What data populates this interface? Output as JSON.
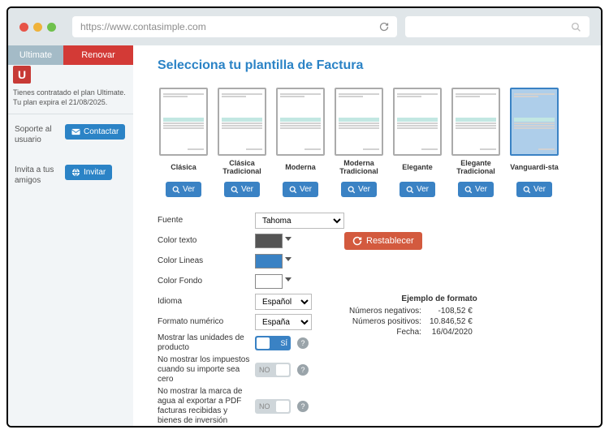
{
  "chrome": {
    "url": "https://www.contasimple.com"
  },
  "sidebar": {
    "plan_name": "Ultimate",
    "renew_label": "Renovar",
    "u_letter": "U",
    "plan_desc": "Tienes contratado el plan Ultimate. Tu plan expira el 21/08/2025.",
    "support_label": "Soporte al usuario",
    "contact_label": "Contactar",
    "invite_label": "Invita a tus amigos",
    "invite_btn": "Invitar"
  },
  "page_title": "Selecciona tu plantilla de Factura",
  "templates": [
    {
      "name": "Clásica"
    },
    {
      "name": "Clásica Tradicional"
    },
    {
      "name": "Moderna"
    },
    {
      "name": "Moderna Tradicional"
    },
    {
      "name": "Elegante"
    },
    {
      "name": "Elegante Tradicional"
    },
    {
      "name": "Vanguardi-sta"
    }
  ],
  "selected_template_index": 6,
  "ver_label": "Ver",
  "settings": {
    "font_label": "Fuente",
    "font_value": "Tahoma",
    "text_color_label": "Color texto",
    "text_color_value": "#555555",
    "line_color_label": "Color Lineas",
    "line_color_value": "#3a82c4",
    "bg_color_label": "Color Fondo",
    "bg_color_value": "#ffffff",
    "reset_label": "Restablecer",
    "lang_label": "Idioma",
    "lang_value": "Español",
    "numfmt_label": "Formato numérico",
    "numfmt_value": "España",
    "units_label": "Mostrar las unidades de producto",
    "units_on": "SÍ",
    "hide_tax_label": "No mostrar los impuestos cuando su importe sea cero",
    "no_label": "NO",
    "watermark_label": "No mostrar la marca de agua al exportar a PDF facturas recibidas y bienes de inversión"
  },
  "example": {
    "title": "Ejemplo de formato",
    "neg_label": "Números negativos:",
    "neg_value": "-108,52 €",
    "pos_label": "Números positivos:",
    "pos_value": "10.846,52 €",
    "date_label": "Fecha:",
    "date_value": "16/04/2020"
  }
}
